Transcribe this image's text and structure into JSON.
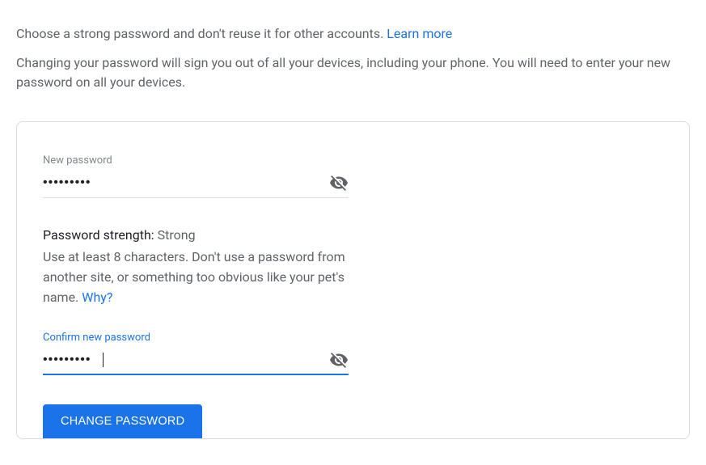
{
  "intro": {
    "line1_text": "Choose a strong password and don't reuse it for other accounts. ",
    "line1_link": "Learn more",
    "line2_text": "Changing your password will sign you out of all your devices, including your phone. You will need to enter your new password on all your devices."
  },
  "new_password": {
    "label": "New password",
    "value": "•••••••••"
  },
  "strength": {
    "label": "Password strength: ",
    "value": "Strong",
    "advice": "Use at least 8 characters. Don't use a password from another site, or something too obvious like your pet's name. ",
    "why_link": "Why?"
  },
  "confirm_password": {
    "label": "Confirm new password",
    "value": "•••••••••"
  },
  "button": {
    "label": "CHANGE PASSWORD"
  }
}
